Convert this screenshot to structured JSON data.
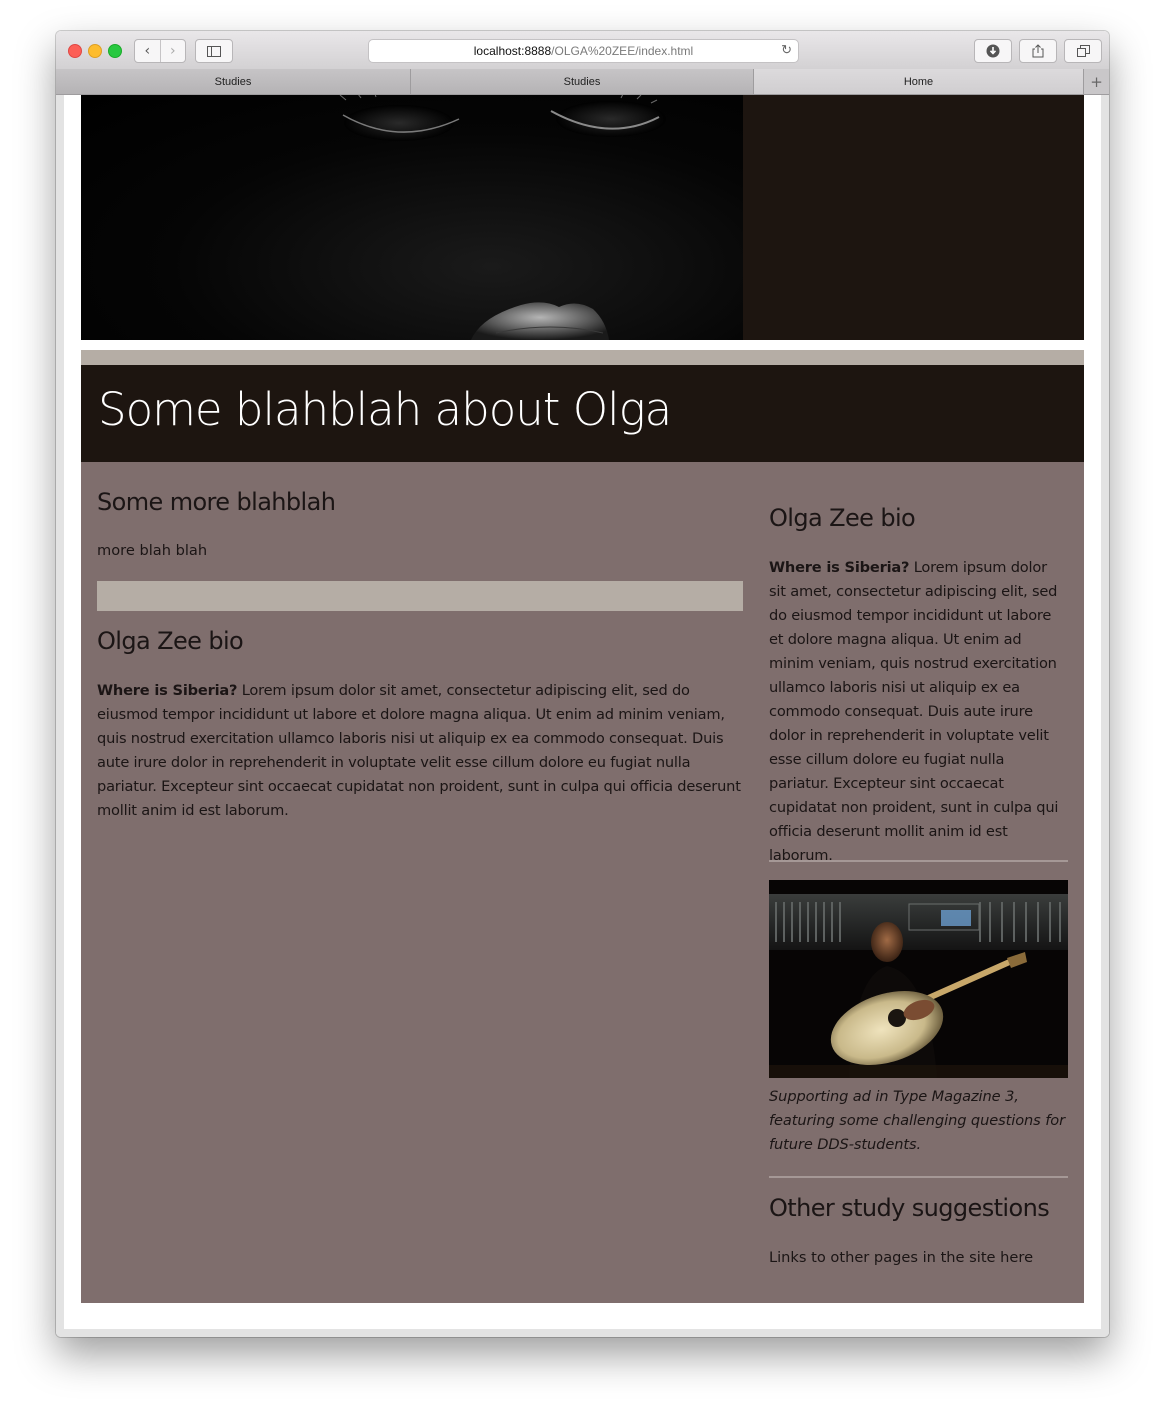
{
  "browser": {
    "url_host": "localhost:8888",
    "url_path": "/OLGA%20ZEE/index.html",
    "tabs": [
      {
        "label": "Studies"
      },
      {
        "label": "Studies"
      },
      {
        "label": "Home"
      }
    ],
    "icons": {
      "back": "chevron-left-icon",
      "forward": "chevron-right-icon",
      "sidebar": "sidebar-icon",
      "reload": "reload-icon",
      "download": "download-icon",
      "share": "share-icon",
      "tabs_overview": "tabs-overview-icon",
      "new_tab": "plus-icon"
    }
  },
  "page": {
    "banner_title": "Some blahblah about Olga",
    "main": {
      "heading_1": "Some more blahblah",
      "text_1": "more blah blah",
      "heading_2": "Olga Zee bio",
      "bio_lead": "Where is Siberia?",
      "bio_text": " Lorem ipsum dolor sit amet, consectetur adipiscing elit, sed do eiusmod tempor incididunt ut labore et dolore magna aliqua. Ut enim ad minim veniam, quis nostrud exercitation ullamco laboris nisi ut aliquip ex ea commodo consequat. Duis aute irure dolor in reprehenderit in voluptate velit esse cillum dolore eu fugiat nulla pariatur. Excepteur sint occaecat cupidatat non proident, sunt in culpa qui officia deserunt mollit anim id est laborum."
    },
    "aside": {
      "heading_1": "Olga Zee bio",
      "bio_lead": "Where is Siberia?",
      "bio_text": " Lorem ipsum dolor sit amet, consectetur adipiscing elit, sed do eiusmod tempor incididunt ut labore et dolore magna aliqua. Ut enim ad minim veniam, quis nostrud exercitation ullamco laboris nisi ut aliquip ex ea commodo consequat. Duis aute irure dolor in reprehenderit in voluptate velit esse cillum dolore eu fugiat nulla pariatur. Excepteur sint occaecat cupidatat non proident, sunt in culpa qui officia deserunt mollit anim id est laborum.",
      "caption": "Supporting ad in Type Magazine 3, featuring some challenging questions for future DDS-students.",
      "heading_2": "Other study suggestions",
      "text_2": "Links to other pages in the site here"
    },
    "colors": {
      "dark_brown": "#1d1510",
      "mauve": "#7f6e6d",
      "band": "#b5ada5",
      "text": "#1b1515"
    }
  }
}
